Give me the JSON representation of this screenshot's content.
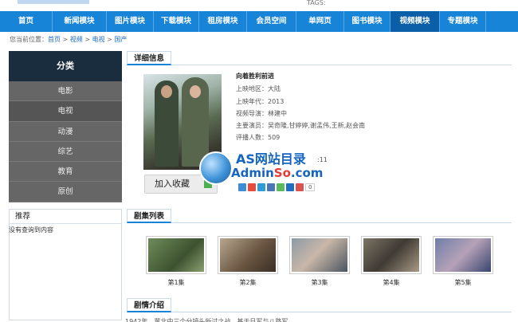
{
  "header": {
    "tags_label": "TAGS:"
  },
  "nav": {
    "items": [
      {
        "label": "首页",
        "active": false
      },
      {
        "label": "新闻模块",
        "active": false
      },
      {
        "label": "图片模块",
        "active": false
      },
      {
        "label": "下载模块",
        "active": false
      },
      {
        "label": "租房模块",
        "active": false
      },
      {
        "label": "会员空间",
        "active": false
      },
      {
        "label": "单网页",
        "active": false
      },
      {
        "label": "图书模块",
        "active": false
      },
      {
        "label": "视频模块",
        "active": true
      },
      {
        "label": "专题模块",
        "active": false
      }
    ]
  },
  "breadcrumb": {
    "prefix": "您当前位置：",
    "items": [
      "首页",
      "视频",
      "电视",
      "国产"
    ],
    "separator": " > "
  },
  "sidebar": {
    "heading": "分类",
    "items": [
      {
        "label": "电影",
        "active": false
      },
      {
        "label": "电视",
        "active": true
      },
      {
        "label": "动漫",
        "active": false
      },
      {
        "label": "综艺",
        "active": false
      },
      {
        "label": "教育",
        "active": false
      },
      {
        "label": "原创",
        "active": false
      }
    ]
  },
  "recommend": {
    "title": "推荐",
    "empty_text": "没有查询到内容"
  },
  "detail": {
    "section_title": "详细信息",
    "video_title": "向着胜利前进",
    "fields": [
      {
        "label": "上映地区：",
        "value": "大陆"
      },
      {
        "label": "上映年代：",
        "value": "2013"
      },
      {
        "label": "视频导演：",
        "value": "林建中"
      },
      {
        "label": "主要演员：",
        "value": "吴奇隆,甘婷婷,谢孟伟,王新,赵会南"
      },
      {
        "label": "评播人数：",
        "value": "509"
      }
    ],
    "update_suffix": ":11",
    "favorite_button": "加入收藏",
    "share_count": "0"
  },
  "watermark": {
    "line1": "AS网站目录",
    "line2_a": "Admin",
    "line2_b": "So",
    "line2_c": ".com"
  },
  "episodes": {
    "section_title": "剧集列表",
    "items": [
      {
        "label": "第1集"
      },
      {
        "label": "第2集"
      },
      {
        "label": "第3集"
      },
      {
        "label": "第4集"
      },
      {
        "label": "第5集"
      }
    ]
  },
  "synopsis": {
    "section_title": "剧情介绍",
    "text": "1942年，冀北中三个分镜头所过之战，基于日军与八路军……"
  },
  "colors": {
    "nav_bg": "#1784d8",
    "nav_active": "#0b5fa8",
    "sidebar_head": "#1a2d3f",
    "sidebar_bg": "#666666",
    "link": "#1a6cc4"
  }
}
